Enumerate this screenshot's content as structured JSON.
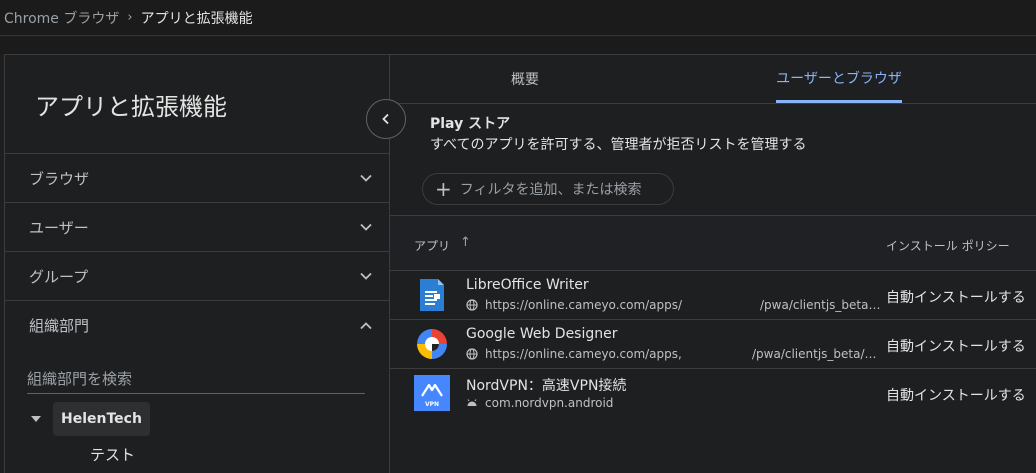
{
  "breadcrumb": {
    "root": "Chrome ブラウザ",
    "separator": "›",
    "current": "アプリと拡張機能"
  },
  "sidebar": {
    "title": "アプリと拡張機能",
    "sections": [
      {
        "label": "ブラウザ",
        "state": "collapsed"
      },
      {
        "label": "ユーザー",
        "state": "collapsed"
      },
      {
        "label": "グループ",
        "state": "collapsed"
      },
      {
        "label": "組織部門",
        "state": "expanded"
      }
    ],
    "org_search_placeholder": "組織部門を検索",
    "tree": {
      "root": "HelenTech",
      "child": "テスト"
    }
  },
  "tabs": [
    {
      "label": "概要",
      "active": false
    },
    {
      "label": "ユーザーとブラウザ",
      "active": true
    }
  ],
  "store": {
    "title": "Play ストア",
    "subtitle": "すべてのアプリを許可する、管理者が拒否リストを管理する"
  },
  "filter": {
    "label": "フィルタを追加、または検索"
  },
  "table": {
    "col_app": "アプリ",
    "col_policy": "インストール ポリシー",
    "rows": [
      {
        "name": "LibreOffice Writer",
        "url": "https://online.cameyo.com/apps/",
        "path": "/pwa/clientjs_beta…",
        "policy": "自動インストールする",
        "icon": "libreoffice-writer-icon"
      },
      {
        "name": "Google Web Designer",
        "url": "https://online.cameyo.com/apps,",
        "path": "/pwa/clientjs_beta/…",
        "policy": "自動インストールする",
        "icon": "google-web-designer-icon"
      },
      {
        "name": "NordVPN：高速VPN接続",
        "url": "com.nordvpn.android",
        "path": "",
        "policy": "自動インストールする",
        "icon": "nordvpn-icon"
      }
    ]
  },
  "colors": {
    "accent": "#8ab4f8",
    "background": "#1e1f20",
    "border": "#3c3c3c"
  }
}
